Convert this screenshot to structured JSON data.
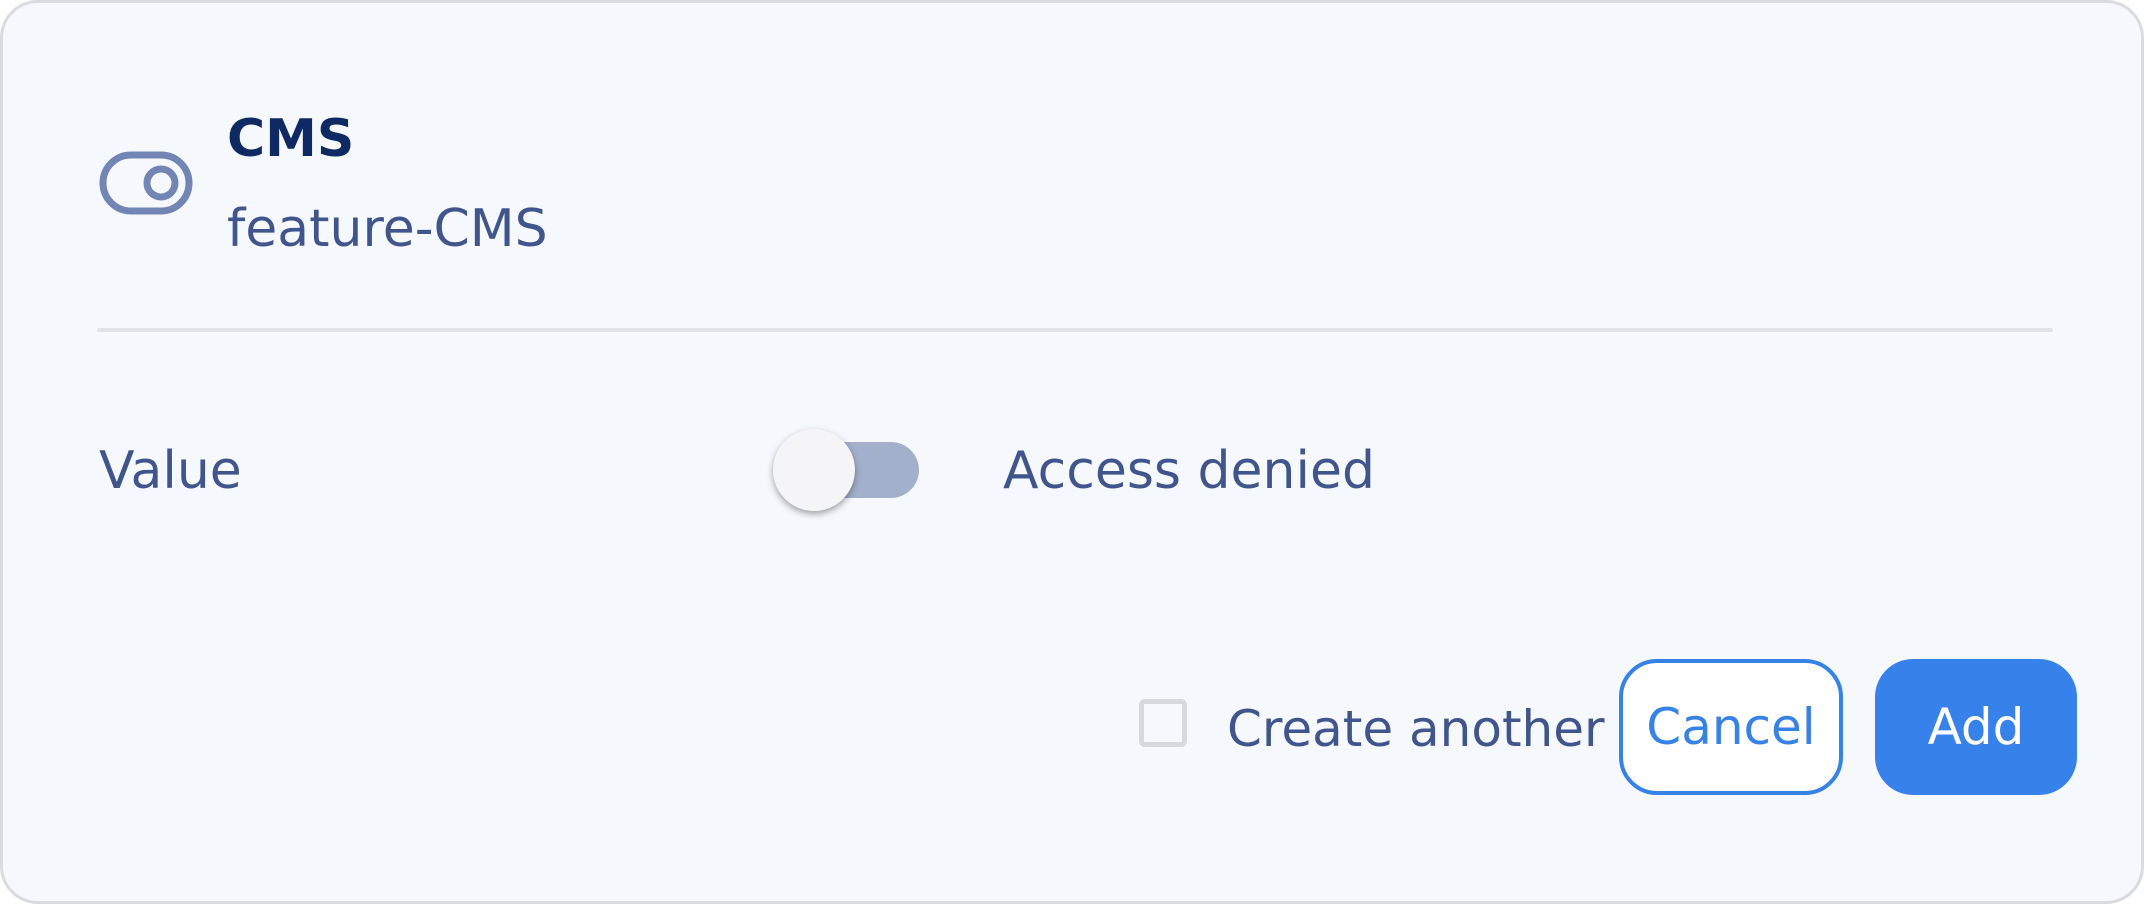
{
  "header": {
    "icon": "toggle-switch-icon",
    "title": "CMS",
    "subtitle": "feature-CMS"
  },
  "field": {
    "label": "Value",
    "toggle_on": false,
    "state_text": "Access denied"
  },
  "footer": {
    "create_another_label": "Create another",
    "create_another_checked": false,
    "cancel_label": "Cancel",
    "add_label": "Add"
  },
  "colors": {
    "background": "#f5f9fd",
    "title": "#0f2a63",
    "text": "#40558b",
    "accent": "#3782e6",
    "toggle_track_off": "#a2b0cc"
  }
}
